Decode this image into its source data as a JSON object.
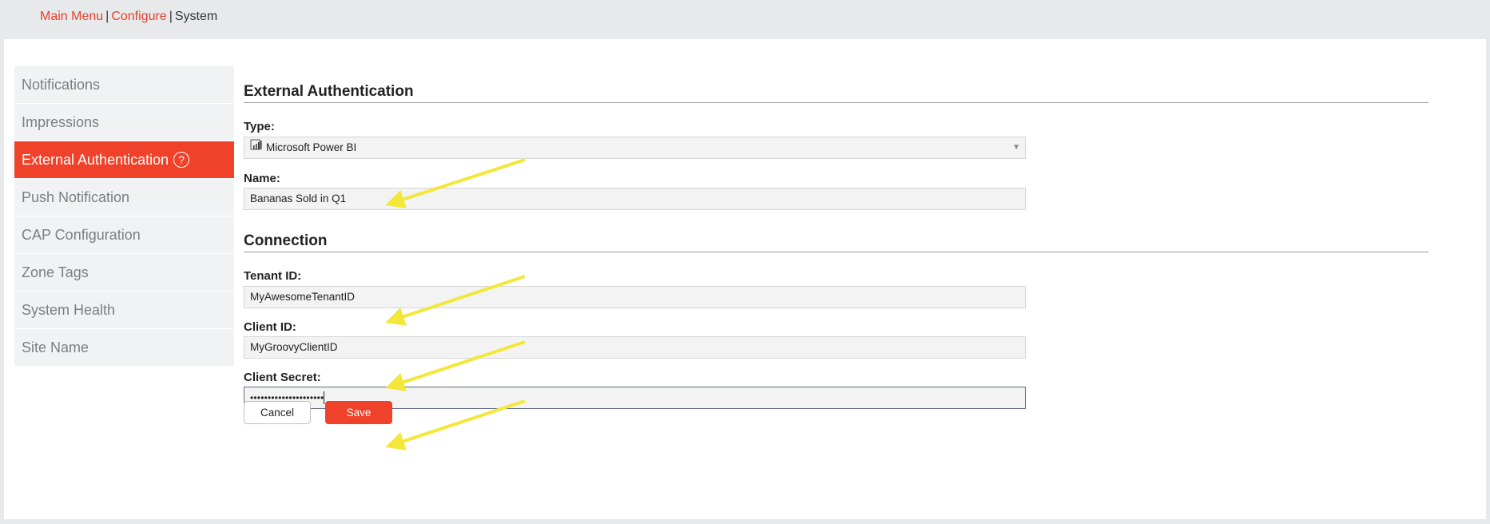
{
  "breadcrumb": {
    "items": [
      "Main Menu",
      "Configure",
      "System"
    ],
    "separator": "|"
  },
  "sidebar": {
    "items": [
      {
        "label": "Notifications",
        "active": false
      },
      {
        "label": "Impressions",
        "active": false
      },
      {
        "label": "External Authentication",
        "active": true,
        "icon": "help-icon"
      },
      {
        "label": "Push Notification",
        "active": false
      },
      {
        "label": "CAP Configuration",
        "active": false
      },
      {
        "label": "Zone Tags",
        "active": false
      },
      {
        "label": "System Health",
        "active": false
      },
      {
        "label": "Site Name",
        "active": false
      }
    ],
    "help_glyph": "?"
  },
  "external_auth": {
    "title": "External Authentication",
    "type_label": "Type:",
    "type_value": "Microsoft Power BI",
    "type_icon": "power-bi-icon",
    "name_label": "Name:",
    "name_value": "Bananas Sold in Q1"
  },
  "connection": {
    "title": "Connection",
    "tenant_label": "Tenant ID:",
    "tenant_value": "MyAwesomeTenantID",
    "client_label": "Client ID:",
    "client_value": "MyGroovyClientID",
    "secret_label": "Client Secret:",
    "secret_value": "•••••••••••••••••••••"
  },
  "actions": {
    "cancel_label": "Cancel",
    "save_label": "Save"
  },
  "colors": {
    "accent": "#f0412a",
    "link": "#e8402a",
    "annotation_arrow": "#f3e83a"
  }
}
